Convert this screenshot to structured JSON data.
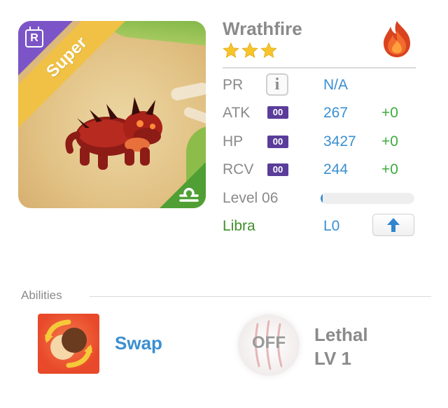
{
  "monster": {
    "name": "Wrathfire",
    "rarity_label": "Super",
    "rank_badge": "R",
    "stars": 3,
    "element_icon": "fire-element-icon",
    "zodiac_icon": "libra-icon",
    "colors": {
      "rarity_ribbon": "#f0c144",
      "rank_corner": "#7b55c7",
      "zodiac_corner": "#4f9f34",
      "star": "#f7c52b",
      "value_blue": "#3a8fd1",
      "bonus_green": "#3faa3f"
    }
  },
  "stats": {
    "pr": {
      "label": "PR",
      "value": "N/A"
    },
    "atk": {
      "label": "ATK",
      "badge": "00",
      "value": "267",
      "bonus": "+0"
    },
    "hp": {
      "label": "HP",
      "badge": "00",
      "value": "3427",
      "bonus": "+0"
    },
    "rcv": {
      "label": "RCV",
      "badge": "00",
      "value": "244",
      "bonus": "+0"
    },
    "level": {
      "label": "Level 06",
      "progress_fraction": 0.02
    },
    "zodiac": {
      "name": "Libra",
      "level": "L0"
    }
  },
  "abilities": {
    "title": "Abilities",
    "items": [
      {
        "name": "Swap",
        "icon": "swap-ability-icon"
      },
      {
        "name": "Lethal",
        "level": "LV 1",
        "status": "OFF",
        "icon": "claw-ability-icon"
      }
    ]
  }
}
